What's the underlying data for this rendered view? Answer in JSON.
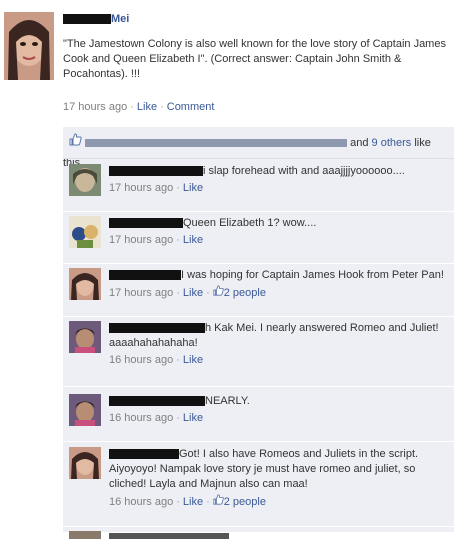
{
  "post": {
    "author_name": "Mei",
    "text": "\"The Jamestown Colony is also well known for the love story of Captain James Cook and Queen Elizabeth I\". (Correct answer: Captain John Smith & Pocahontas). !!!",
    "time": "17 hours ago",
    "like_label": "Like",
    "comment_label": "Comment"
  },
  "likes": {
    "others_label": "9 others",
    "and_label": "and",
    "suffix": "like this."
  },
  "comments": [
    {
      "text": "i slap forehead with and aaajjjjyoooooo....",
      "time": "17 hours ago",
      "like_label": "Like",
      "likes_count": ""
    },
    {
      "text": "Queen Elizabeth 1? wow....",
      "time": "17 hours ago",
      "like_label": "Like",
      "likes_count": ""
    },
    {
      "text": "I was hoping for Captain James Hook from Peter Pan!",
      "time": "17 hours ago",
      "like_label": "Like",
      "likes_count": "2 people"
    },
    {
      "text": "h Kak Mei. I nearly answered Romeo and Juliet! aaaahahahahaha!",
      "time": "16 hours ago",
      "like_label": "Like",
      "likes_count": ""
    },
    {
      "text": "NEARLY.",
      "time": "16 hours ago",
      "like_label": "Like",
      "likes_count": ""
    },
    {
      "text": "Got! I also have Romeos and Juliets in the script. Aiyoyoyo! Nampak love story je must have romeo and juliet, so cliched! Layla and Majnun also can maa!",
      "time": "16 hours ago",
      "like_label": "Like",
      "likes_count": "2 people"
    }
  ]
}
